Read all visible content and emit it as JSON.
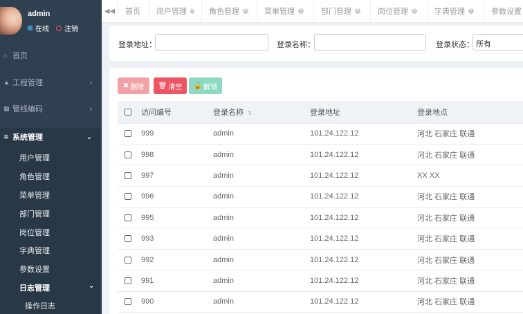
{
  "user": {
    "name": "admin",
    "status": "在线",
    "logout": "注销"
  },
  "sidebar": {
    "items": [
      {
        "label": "首页",
        "icon": "home-icon",
        "glyph": "⌂"
      },
      {
        "label": "工程管理",
        "icon": "bell-icon",
        "glyph": "▲"
      },
      {
        "label": "管线编码",
        "icon": "building-icon",
        "glyph": "▦"
      },
      {
        "label": "系统管理",
        "icon": "gear-icon",
        "glyph": "✲"
      }
    ],
    "sub_items": [
      "用户管理",
      "角色管理",
      "菜单管理",
      "部门管理",
      "岗位管理",
      "字典管理",
      "参数设置",
      "日志管理"
    ],
    "sub_sub_items": [
      "操作日志"
    ]
  },
  "tabs": [
    {
      "label": "首页",
      "closable": false
    },
    {
      "label": "用户管理",
      "closable": true
    },
    {
      "label": "角色管理",
      "closable": true
    },
    {
      "label": "菜单管理",
      "closable": true
    },
    {
      "label": "部门管理",
      "closable": true
    },
    {
      "label": "岗位管理",
      "closable": true
    },
    {
      "label": "字典管理",
      "closable": true
    },
    {
      "label": "参数设置",
      "closable": false
    }
  ],
  "search": {
    "addr_label": "登录地址：",
    "name_label": "登录名称：",
    "status_label": "登录状态：",
    "status_value": "所有"
  },
  "toolbar": {
    "delete": "删除",
    "clean": "清空",
    "unlock": "解锁"
  },
  "table": {
    "headers": [
      "访问编号",
      "登录名称",
      "登录地址",
      "登录地点"
    ],
    "rows": [
      {
        "id": "999",
        "name": "admin",
        "addr": "101.24.122.12",
        "loc": "河北 石家庄 联通"
      },
      {
        "id": "998",
        "name": "admin",
        "addr": "101.24.122.12",
        "loc": "河北 石家庄 联通"
      },
      {
        "id": "997",
        "name": "admin",
        "addr": "101.24.122.12",
        "loc": "XX XX"
      },
      {
        "id": "996",
        "name": "admin",
        "addr": "101.24.122.12",
        "loc": "河北 石家庄 联通"
      },
      {
        "id": "995",
        "name": "admin",
        "addr": "101.24.122.12",
        "loc": "河北 石家庄 联通"
      },
      {
        "id": "993",
        "name": "admin",
        "addr": "101.24.122.12",
        "loc": "河北 石家庄 联通"
      },
      {
        "id": "992",
        "name": "admin",
        "addr": "101.24.122.12",
        "loc": "河北 石家庄 联通"
      },
      {
        "id": "991",
        "name": "admin",
        "addr": "101.24.122.12",
        "loc": "河北 石家庄 联通"
      },
      {
        "id": "990",
        "name": "admin",
        "addr": "101.24.122.12",
        "loc": "河北 石家庄 联通"
      }
    ]
  },
  "colors": {
    "sidebar": "#2f4050",
    "danger": "#ed5565",
    "success": "#1ab394"
  }
}
